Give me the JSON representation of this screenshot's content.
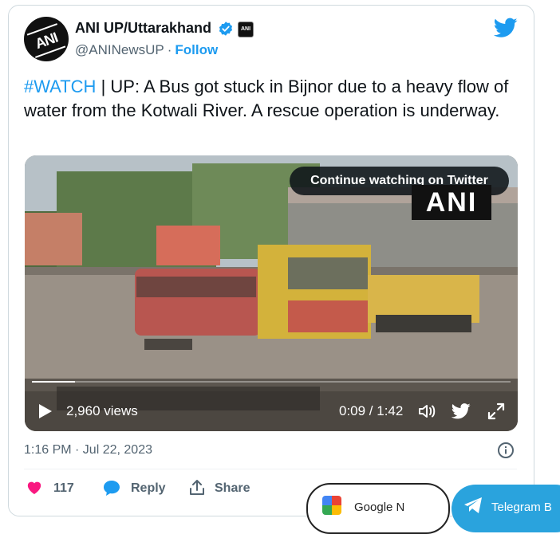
{
  "tweet": {
    "author_name": "ANI UP/Uttarakhand",
    "author_handle": "@ANINewsUP",
    "separator": "·",
    "follow_label": "Follow",
    "hashtag": "#WATCH",
    "text_rest": " | UP: A Bus got stuck in Bijnor due to a heavy flow of water from the Kotwali River. A rescue operation is underway.",
    "timestamp": "1:16 PM · Jul 22, 2023",
    "likes": "117",
    "reply_label": "Reply",
    "share_label": "Share"
  },
  "video": {
    "continue_label": "Continue watching on Twitter",
    "watermark": "ANI",
    "views": "2,960 views",
    "time": "0:09 / 1:42",
    "progress_fraction": 0.09
  },
  "overlays": {
    "left_label": "Google N",
    "right_label": "Telegram B"
  },
  "colors": {
    "twitter_blue": "#1d9bf0",
    "like_pink": "#f91880",
    "muted_text": "#536471"
  },
  "icons": [
    "twitter-bird-icon",
    "verified-badge-icon",
    "play-icon",
    "volume-icon",
    "fullscreen-icon",
    "info-icon",
    "heart-icon",
    "reply-icon",
    "share-icon"
  ]
}
